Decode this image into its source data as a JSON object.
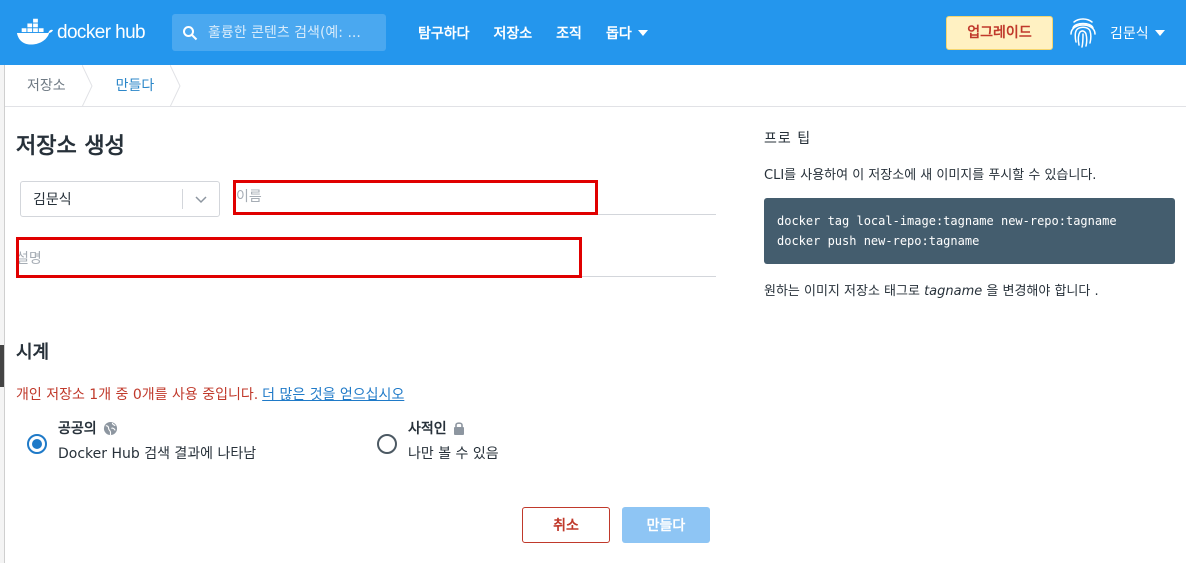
{
  "header": {
    "logo_text": "docker hub",
    "search_placeholder": "훌륭한 콘텐츠 검색(예: ...",
    "nav": [
      "탐구하다",
      "저장소",
      "조직",
      "돕다"
    ],
    "upgrade_label": "업그레이드",
    "username": "김문식"
  },
  "breadcrumb": [
    "저장소",
    "만들다"
  ],
  "form": {
    "title": "저장소 생성",
    "namespace_value": "김문식",
    "name_placeholder": "이름",
    "description_placeholder": "설명",
    "visibility_title": "시계",
    "quota_text": "개인 저장소 1개 중 0개를 사용 중입니다.",
    "quota_link": "더 많은 것을 얻으십시오",
    "public": {
      "label": "공공의",
      "description": "Docker Hub 검색 결과에 나타남",
      "selected": true
    },
    "private": {
      "label": "사적인",
      "description": "나만 볼 수 있음",
      "selected": false
    },
    "cancel_label": "취소",
    "create_label": "만들다"
  },
  "pro_tip": {
    "title": "프로 팁",
    "text": "CLI를 사용하여 이 저장소에 새 이미지를 푸시할 수 있습니다.",
    "code_line1": "docker tag local-image:tagname new-repo:tagname",
    "code_line2": "docker push new-repo:tagname",
    "footer_before": "원하는 이미지 저장소 태그로",
    "footer_tag": "tagname",
    "footer_after": "을 변경해야 합니다 ."
  },
  "colors": {
    "brand": "#2496ed",
    "danger": "#c0392b",
    "link": "#1f7ac8",
    "highlight": "#e00000"
  }
}
